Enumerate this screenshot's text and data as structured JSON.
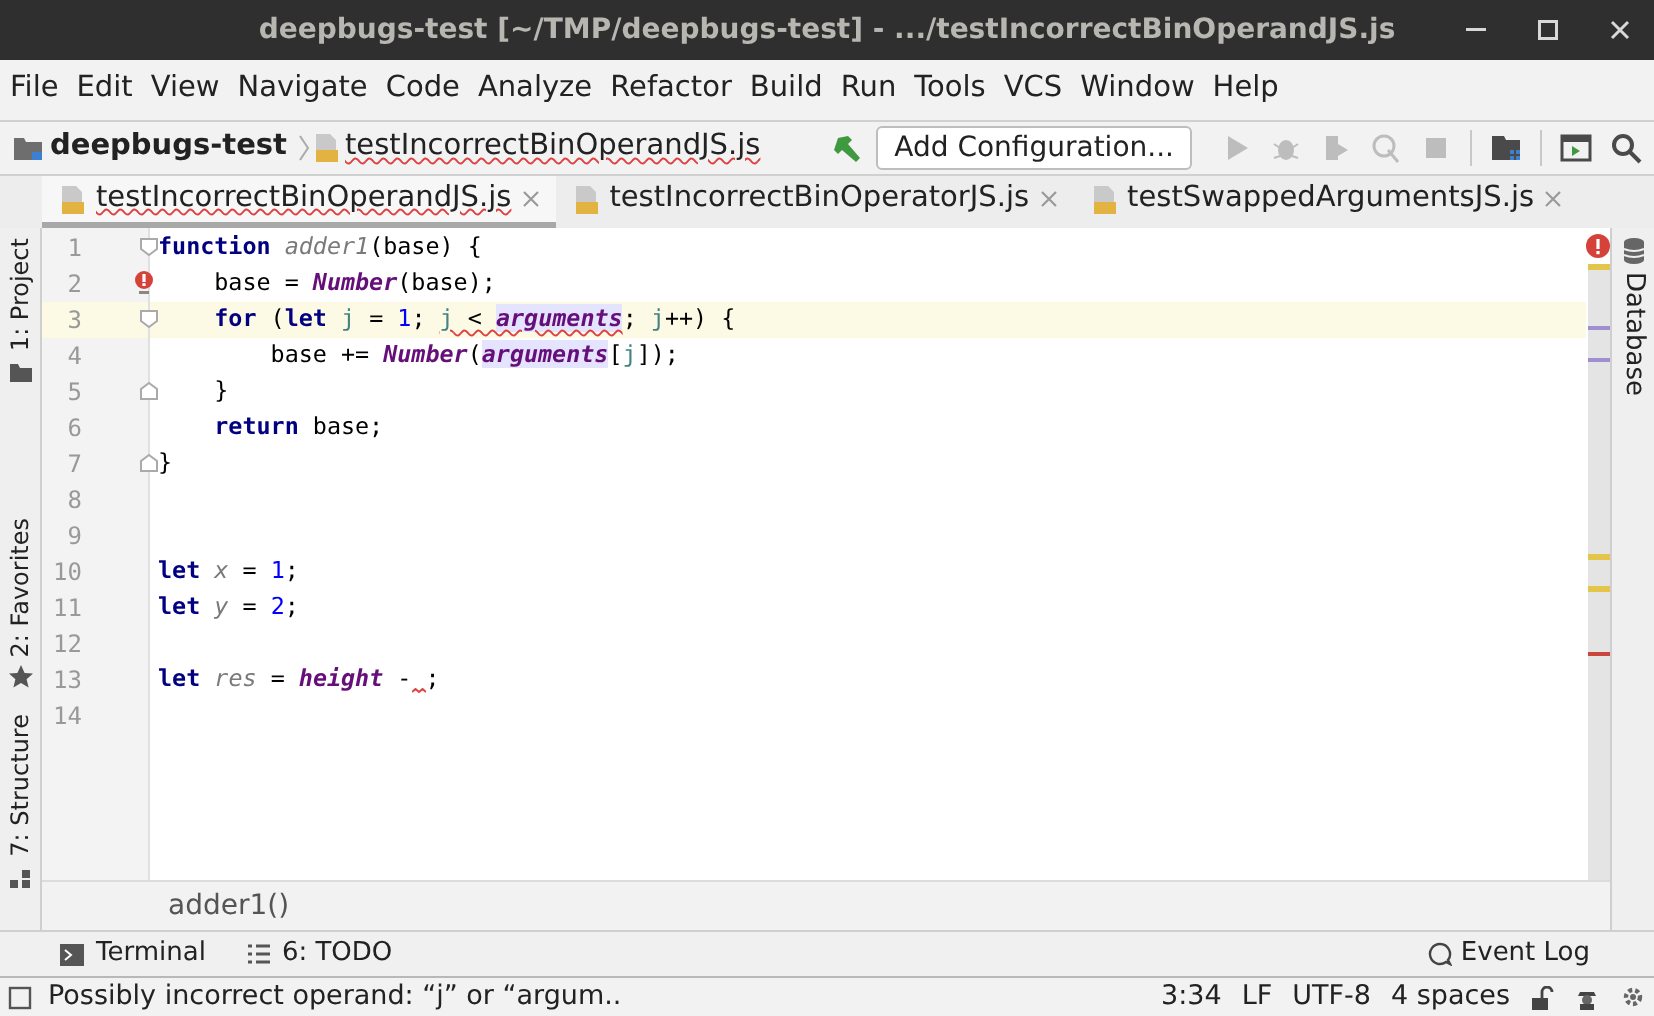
{
  "window": {
    "title": "deepbugs-test [~/TMP/deepbugs-test] - .../testIncorrectBinOperandJS.js"
  },
  "menu": [
    "File",
    "Edit",
    "View",
    "Navigate",
    "Code",
    "Analyze",
    "Refactor",
    "Build",
    "Run",
    "Tools",
    "VCS",
    "Window",
    "Help"
  ],
  "breadcrumb": [
    {
      "kind": "project",
      "label": "deepbugs-test"
    },
    {
      "kind": "file",
      "label": "testIncorrectBinOperandJS.js",
      "squiggle": true
    }
  ],
  "run_config": {
    "label": "Add Configuration..."
  },
  "toolbar": [
    {
      "kind": "run",
      "disabled": true
    },
    {
      "kind": "debug",
      "disabled": true
    },
    {
      "kind": "coverage",
      "disabled": true
    },
    {
      "kind": "profile",
      "disabled": true
    },
    {
      "kind": "stop",
      "disabled": true
    },
    {
      "kind": "structure",
      "disabled": false
    },
    {
      "kind": "terminal",
      "disabled": false
    },
    {
      "kind": "search",
      "disabled": false
    }
  ],
  "tabs": [
    {
      "label": "testIncorrectBinOperandJS.js",
      "selected": true,
      "squiggle": true
    },
    {
      "label": "testIncorrectBinOperatorJS.js",
      "selected": false,
      "squiggle": false
    },
    {
      "label": "testSwappedArgumentsJS.js",
      "selected": false,
      "squiggle": false
    }
  ],
  "left_tools": [
    {
      "kind": "project",
      "label": "1: Project"
    },
    {
      "kind": "favorites",
      "label": "2: Favorites"
    },
    {
      "kind": "structure",
      "label": "7: Structure"
    }
  ],
  "right_tools": [
    {
      "label": "Database"
    }
  ],
  "editor": {
    "lines": [
      {
        "number": "1",
        "fold_start": true,
        "fold_end": false,
        "current": false,
        "error": false,
        "tokens": [
          {
            "text": "function",
            "kind": "kw",
            "squiggle": false
          },
          {
            "text": " adder1",
            "kind": "decl",
            "squiggle": false
          },
          {
            "text": "(base) {",
            "kind": "plain",
            "squiggle": false
          }
        ]
      },
      {
        "number": "2",
        "fold_start": false,
        "fold_end": false,
        "current": false,
        "error": true,
        "tokens": [
          {
            "text": "    base = ",
            "kind": "plain",
            "squiggle": false
          },
          {
            "text": "Number",
            "kind": "fn",
            "squiggle": false
          },
          {
            "text": "(base);",
            "kind": "plain",
            "squiggle": false
          }
        ]
      },
      {
        "number": "3",
        "fold_start": true,
        "fold_end": false,
        "current": true,
        "error": false,
        "tokens": [
          {
            "text": "    for",
            "kind": "kw",
            "squiggle": false
          },
          {
            "text": " (",
            "kind": "plain",
            "squiggle": false
          },
          {
            "text": "let",
            "kind": "kw",
            "squiggle": false
          },
          {
            "text": " j",
            "kind": "local",
            "squiggle": false
          },
          {
            "text": " = ",
            "kind": "plain",
            "squiggle": false
          },
          {
            "text": "1",
            "kind": "num",
            "squiggle": false
          },
          {
            "text": "; ",
            "kind": "plain",
            "squiggle": false
          },
          {
            "text": "j",
            "kind": "local",
            "squiggle": true
          },
          {
            "text": " < ",
            "kind": "plain",
            "squiggle": true
          },
          {
            "text": "arguments",
            "kind": "arg",
            "squiggle": true
          },
          {
            "text": "; ",
            "kind": "plain",
            "squiggle": false
          },
          {
            "text": "j",
            "kind": "local",
            "squiggle": false
          },
          {
            "text": "++) {",
            "kind": "plain",
            "squiggle": false
          }
        ]
      },
      {
        "number": "4",
        "fold_start": false,
        "fold_end": false,
        "current": false,
        "error": false,
        "tokens": [
          {
            "text": "        base += ",
            "kind": "plain",
            "squiggle": false
          },
          {
            "text": "Number",
            "kind": "fn",
            "squiggle": false
          },
          {
            "text": "(",
            "kind": "plain",
            "squiggle": false
          },
          {
            "text": "arguments",
            "kind": "arg",
            "squiggle": false
          },
          {
            "text": "[",
            "kind": "plain",
            "squiggle": false
          },
          {
            "text": "j",
            "kind": "local",
            "squiggle": false
          },
          {
            "text": "]);",
            "kind": "plain",
            "squiggle": false
          }
        ]
      },
      {
        "number": "5",
        "fold_start": false,
        "fold_end": true,
        "current": false,
        "error": false,
        "tokens": [
          {
            "text": "    }",
            "kind": "plain",
            "squiggle": false
          }
        ]
      },
      {
        "number": "6",
        "fold_start": false,
        "fold_end": false,
        "current": false,
        "error": false,
        "tokens": [
          {
            "text": "    return",
            "kind": "kw",
            "squiggle": false
          },
          {
            "text": " base;",
            "kind": "plain",
            "squiggle": false
          }
        ]
      },
      {
        "number": "7",
        "fold_start": false,
        "fold_end": true,
        "current": false,
        "error": false,
        "tokens": [
          {
            "text": "}",
            "kind": "plain",
            "squiggle": false
          }
        ]
      },
      {
        "number": "8",
        "fold_start": false,
        "fold_end": false,
        "current": false,
        "error": false
      },
      {
        "number": "9",
        "fold_start": false,
        "fold_end": false,
        "current": false,
        "error": false
      },
      {
        "number": "10",
        "fold_start": false,
        "fold_end": false,
        "current": false,
        "error": false,
        "tokens": [
          {
            "text": "let",
            "kind": "kw",
            "squiggle": false
          },
          {
            "text": " x",
            "kind": "var",
            "squiggle": false
          },
          {
            "text": " = ",
            "kind": "plain",
            "squiggle": false
          },
          {
            "text": "1",
            "kind": "num",
            "squiggle": false
          },
          {
            "text": ";",
            "kind": "plain",
            "squiggle": false
          }
        ]
      },
      {
        "number": "11",
        "fold_start": false,
        "fold_end": false,
        "current": false,
        "error": false,
        "tokens": [
          {
            "text": "let",
            "kind": "kw",
            "squiggle": false
          },
          {
            "text": " y",
            "kind": "var",
            "squiggle": false
          },
          {
            "text": " = ",
            "kind": "plain",
            "squiggle": false
          },
          {
            "text": "2",
            "kind": "num",
            "squiggle": false
          },
          {
            "text": ";",
            "kind": "plain",
            "squiggle": false
          }
        ]
      },
      {
        "number": "12",
        "fold_start": false,
        "fold_end": false,
        "current": false,
        "error": false
      },
      {
        "number": "13",
        "fold_start": false,
        "fold_end": false,
        "current": false,
        "error": false,
        "tokens": [
          {
            "text": "let",
            "kind": "kw",
            "squiggle": false
          },
          {
            "text": " res",
            "kind": "var",
            "squiggle": false
          },
          {
            "text": " = ",
            "kind": "plain",
            "squiggle": false
          },
          {
            "text": "height",
            "kind": "fn",
            "squiggle": false
          },
          {
            "text": " -",
            "kind": "plain",
            "squiggle": false
          },
          {
            "text": ";",
            "kind": "plain",
            "squiggle": false,
            "missing_operand": true
          }
        ]
      },
      {
        "number": "14",
        "fold_start": false,
        "fold_end": false,
        "current": false,
        "error": false
      }
    ],
    "breadcrumb": "adder1()"
  },
  "bottom_tools": [
    {
      "kind": "terminal",
      "label": "Terminal"
    },
    {
      "kind": "todo",
      "label": "6: TODO"
    }
  ],
  "event_log": {
    "label": "Event Log"
  },
  "status_bar": {
    "message": "Possibly incorrect operand: “j” or “argum..",
    "position": "3:34",
    "line_separator": "LF",
    "encoding": "UTF-8",
    "indent": "4 spaces"
  }
}
